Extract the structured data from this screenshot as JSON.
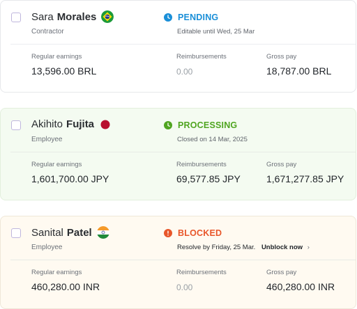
{
  "columns": {
    "regular": "Regular earnings",
    "reimbursements": "Reimbursements",
    "gross": "Gross pay"
  },
  "rows": [
    {
      "first_name": "Sara",
      "last_name": "Morales",
      "flag": "brazil-flag-icon",
      "role": "Contractor",
      "status": "PENDING",
      "status_icon": "clock-icon",
      "status_color": "#1a8fd8",
      "detail": "Editable until Wed, 25 Mar",
      "regular": "13,596.00 BRL",
      "reimbursements": "0.00",
      "gross": "18,787.00 BRL"
    },
    {
      "first_name": "Akihito",
      "last_name": "Fujita",
      "flag": "japan-flag-icon",
      "role": "Employee",
      "status": "PROCESSING",
      "status_icon": "clock-icon",
      "status_color": "#4fa520",
      "detail": "Closed on 14 Mar, 2025",
      "regular": "1,601,700.00 JPY",
      "reimbursements": "69,577.85 JPY",
      "gross": "1,671,277.85 JPY"
    },
    {
      "first_name": "Sanital",
      "last_name": "Patel",
      "flag": "india-flag-icon",
      "role": "Employee",
      "status": "BLOCKED",
      "status_icon": "alert-icon",
      "status_color": "#e8562a",
      "detail": "Resolve by Friday, 25 Mar.",
      "action": "Unblock now",
      "regular": "460,280.00 INR",
      "reimbursements": "0.00",
      "gross": "460,280.00 INR"
    }
  ]
}
